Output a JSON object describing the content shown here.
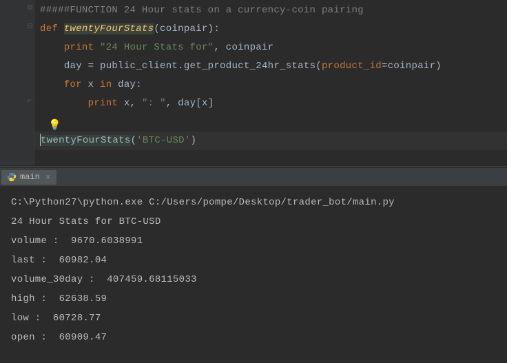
{
  "editor": {
    "lines": {
      "comment": "#####FUNCTION 24 Hour stats on a currency-coin pairing",
      "def_kw": "def ",
      "funcname": "twentyFourStats",
      "def_params": "(coinpair):",
      "print1_kw": "print ",
      "print1_str": "\"24 Hour Stats for\"",
      "print1_rest": ", coinpair",
      "day_assign_pre": "day = public_client.get_product_24hr_stats(",
      "day_assign_kw": "product_id",
      "day_assign_post": "=coinpair)",
      "for_kw1": "for ",
      "for_var": "x ",
      "for_kw2": "in ",
      "for_iter": "day:",
      "print2_kw": "print ",
      "print2_a": "x, ",
      "print2_str": "\": \"",
      "print2_b": ", day[x]",
      "call_name": "twentyFourStats",
      "call_open": "(",
      "call_arg": "'BTC-USD'",
      "call_close": ")"
    }
  },
  "tab": {
    "label": "main",
    "close": "×"
  },
  "console": {
    "lines": [
      "C:\\Python27\\python.exe C:/Users/pompe/Desktop/trader_bot/main.py",
      "24 Hour Stats for BTC-USD",
      "volume :  9670.6038991",
      "last :  60982.04",
      "volume_30day :  407459.68115033",
      "high :  62638.59",
      "low :  60728.77",
      "open :  60909.47"
    ]
  }
}
